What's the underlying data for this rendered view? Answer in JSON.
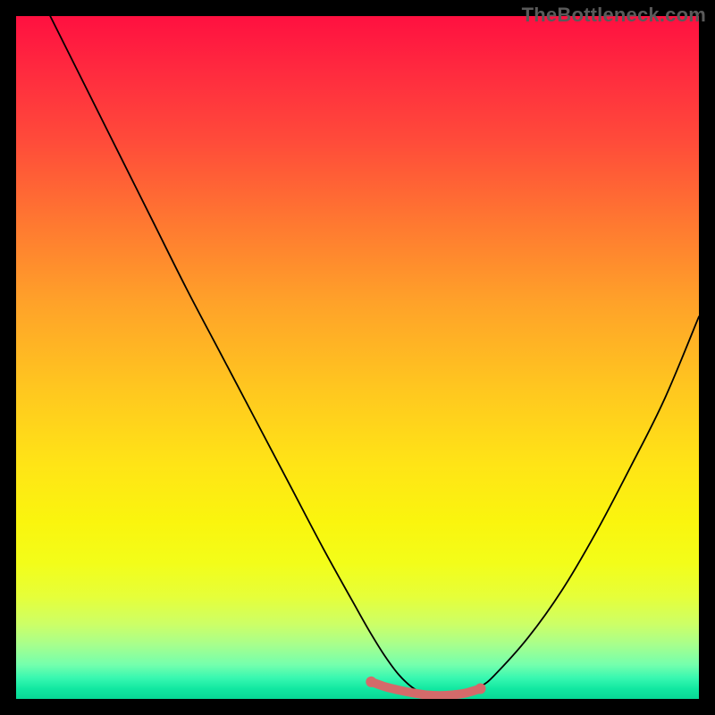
{
  "watermark": "TheBottleneck.com",
  "chart_data": {
    "type": "line",
    "title": "",
    "xlabel": "",
    "ylabel": "",
    "xlim": [
      0,
      100
    ],
    "ylim": [
      0,
      100
    ],
    "grid": false,
    "series": [
      {
        "name": "bottleneck-curve",
        "x": [
          5,
          10,
          15,
          20,
          25,
          30,
          35,
          40,
          45,
          50,
          52,
          54,
          56,
          58,
          60,
          62,
          64,
          66,
          68,
          70,
          75,
          80,
          85,
          90,
          95,
          100
        ],
        "values": [
          100,
          90,
          80,
          70,
          60,
          50.5,
          41,
          31.5,
          22,
          13,
          9.5,
          6.3,
          3.6,
          1.7,
          0.6,
          0.2,
          0.2,
          0.7,
          1.8,
          3.4,
          9,
          16,
          24.5,
          34,
          44,
          56
        ]
      },
      {
        "name": "optimal-band",
        "x": [
          52,
          54,
          56,
          58,
          60,
          62,
          64,
          66,
          68
        ],
        "values": [
          2.5,
          1.8,
          1.3,
          0.9,
          0.6,
          0.5,
          0.6,
          0.9,
          1.5
        ]
      }
    ],
    "colors": {
      "curve": "#000000",
      "band": "#d46a6a"
    }
  }
}
